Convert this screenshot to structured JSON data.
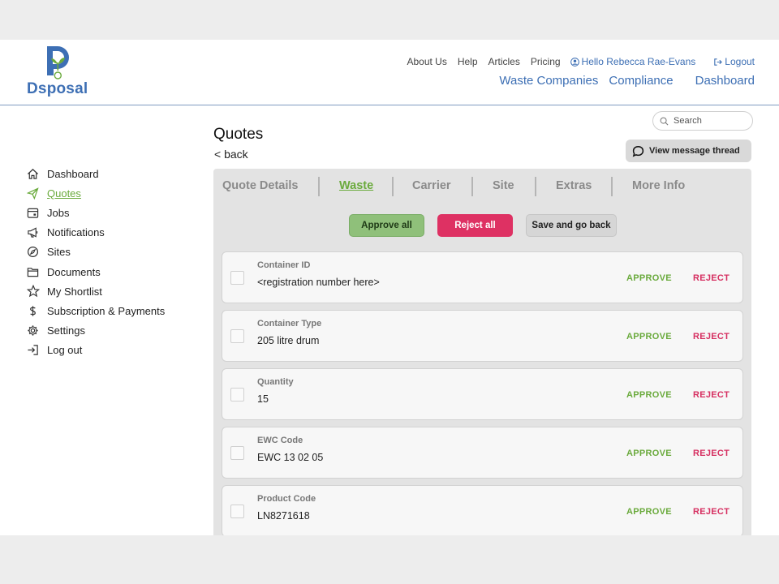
{
  "brand": {
    "name": "Dsposal",
    "primary_color": "#3d6fb4",
    "accent_color": "#6aaa3c"
  },
  "topnav": {
    "links": [
      "About Us",
      "Help",
      "Articles",
      "Pricing"
    ],
    "user": "Hello Rebecca Rae-Evans",
    "logout": "Logout"
  },
  "mainnav": {
    "items": [
      "Waste Companies",
      "Compliance",
      "Dashboard"
    ]
  },
  "sidebar": {
    "items": [
      {
        "label": "Dashboard",
        "icon": "home-icon"
      },
      {
        "label": "Quotes",
        "icon": "paper-plane-icon",
        "active": true
      },
      {
        "label": "Jobs",
        "icon": "calendar-icon"
      },
      {
        "label": "Notifications",
        "icon": "megaphone-icon"
      },
      {
        "label": "Sites",
        "icon": "compass-icon"
      },
      {
        "label": "Documents",
        "icon": "folder-icon"
      },
      {
        "label": "My Shortlist",
        "icon": "star-icon"
      },
      {
        "label": "Subscription & Payments",
        "icon": "dollar-icon"
      },
      {
        "label": "Settings",
        "icon": "gear-icon"
      },
      {
        "label": "Log out",
        "icon": "logout-icon"
      }
    ]
  },
  "page": {
    "title": "Quotes",
    "back": "< back",
    "search_placeholder": "Search",
    "message_button": "View message thread"
  },
  "tabs": [
    {
      "label": "Quote Details"
    },
    {
      "label": "Waste",
      "active": true
    },
    {
      "label": "Carrier"
    },
    {
      "label": "Site"
    },
    {
      "label": "Extras"
    },
    {
      "label": "More Info"
    }
  ],
  "actions": {
    "approve_all": "Approve all",
    "reject_all": "Reject all",
    "save_back": "Save and go back"
  },
  "fields": [
    {
      "label": "Container ID",
      "value": "<registration number here>"
    },
    {
      "label": "Container Type",
      "value": "205 litre drum"
    },
    {
      "label": "Quantity",
      "value": "15"
    },
    {
      "label": "EWC Code",
      "value": "EWC 13 02 05"
    },
    {
      "label": "Product Code",
      "value": "LN8271618"
    }
  ],
  "row_actions": {
    "approve": "APPROVE",
    "reject": "REJECT"
  }
}
